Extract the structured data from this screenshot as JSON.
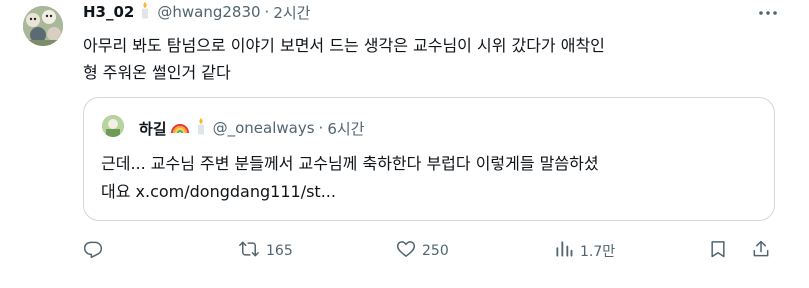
{
  "tweet": {
    "author": {
      "display_name": "H3_02",
      "badge_icon": "candle-icon",
      "handle": "@hwang2830",
      "separator": "·",
      "time": "2시간"
    },
    "text": "아무리 봐도 탐넘으로 이야기 보면서 드는 생각은 교수님이 시위 갔다가 애착인\n형 주워온 썰인거 같다",
    "quote": {
      "display_name": "하길",
      "badge_icons": [
        "rainbow-icon",
        "candle-icon"
      ],
      "handle": "@_onealways",
      "separator": "·",
      "time": "6시간",
      "text_line1": "근데... 교수님 주변 분들께서 교수님께 축하한다 부럽다 이렇게들 말씀하셨",
      "text_line2_prefix": "대요 ",
      "link": "x.com/dongdang111/st..."
    },
    "actions": {
      "reply_count": "",
      "retweet_count": "165",
      "like_count": "250",
      "views_count": "1.7만"
    }
  },
  "colors": {
    "text_primary": "#0f1419",
    "text_secondary": "#536471",
    "border": "#cfd9de"
  }
}
